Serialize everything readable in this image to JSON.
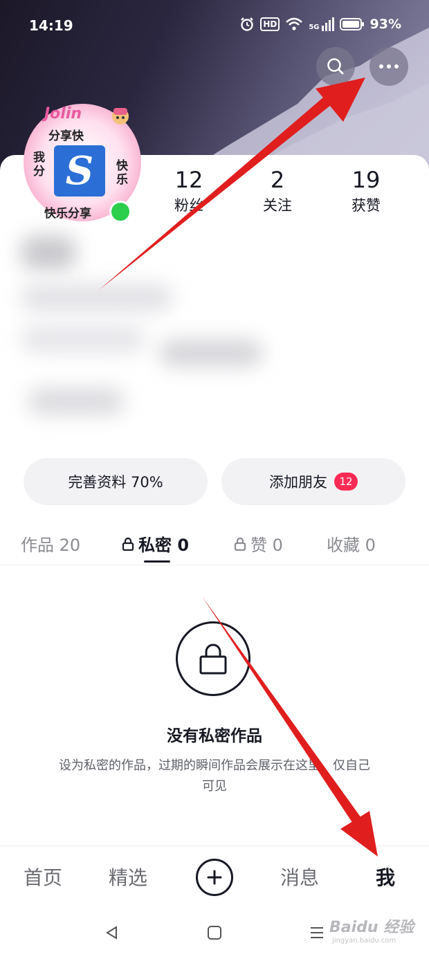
{
  "status_bar": {
    "time": "14:19",
    "hd": "HD",
    "network": "5G",
    "battery": "93%",
    "icons": [
      "alarm-icon",
      "hd-icon",
      "wifi-icon",
      "signal-icon",
      "battery-icon"
    ]
  },
  "header": {
    "buttons": [
      "search-icon",
      "more-icon"
    ]
  },
  "avatar": {
    "text_top_logo": "Jolin",
    "text_top": "分享快",
    "text_left": "我分",
    "text_right": "快乐",
    "text_bottom": "快乐分享",
    "center_letter": "S"
  },
  "stats": [
    {
      "value": "12",
      "label": "粉丝"
    },
    {
      "value": "2",
      "label": "关注"
    },
    {
      "value": "19",
      "label": "获赞"
    }
  ],
  "actions": {
    "complete_profile": "完善资料 70%",
    "add_friends": "添加朋友",
    "add_friends_badge": "12"
  },
  "tabs": [
    {
      "label": "作品 20",
      "locked": false,
      "active": false
    },
    {
      "label": "私密 0",
      "locked": true,
      "active": true
    },
    {
      "label": "赞 0",
      "locked": true,
      "active": false
    },
    {
      "label": "收藏 0",
      "locked": false,
      "active": false
    }
  ],
  "empty_state": {
    "icon": "lock-icon",
    "title": "没有私密作品",
    "description": "设为私密的作品，过期的瞬间作品会展示在这里，仅自己可见"
  },
  "bottom_nav": {
    "home": "首页",
    "featured": "精选",
    "messages": "消息",
    "me": "我"
  },
  "system_nav": [
    "back-icon",
    "home-icon",
    "menu-icon"
  ],
  "watermark": {
    "brand": "Baidu 经验",
    "url": "jingyan.baidu.com"
  },
  "colors": {
    "accent": "#fe2c55",
    "online": "#2ccf4c",
    "text": "#161823",
    "arrow": "#e01e1e"
  }
}
